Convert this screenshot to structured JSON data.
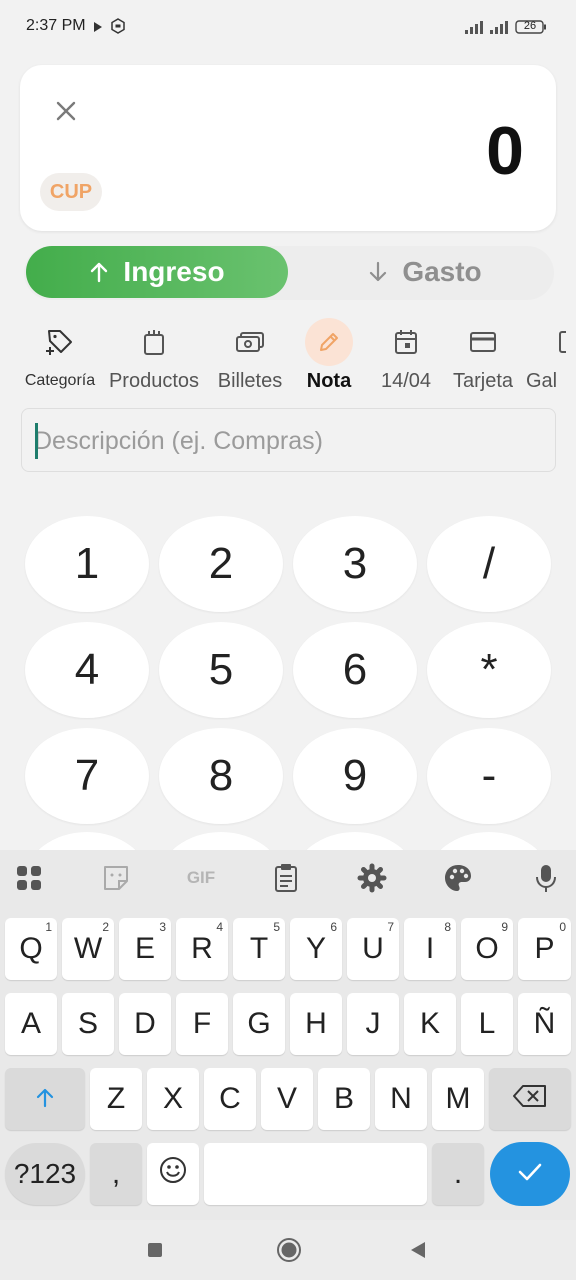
{
  "status_bar": {
    "time": "2:37 PM",
    "battery": "26"
  },
  "amount_card": {
    "amount": "0",
    "currency": "CUP"
  },
  "type_toggle": {
    "income_label": "Ingreso",
    "expense_label": "Gasto"
  },
  "categories": [
    {
      "label": "Categoría",
      "icon": "tag-add-icon"
    },
    {
      "label": "Productos",
      "icon": "shopping-bag-icon"
    },
    {
      "label": "Billetes",
      "icon": "banknote-icon"
    },
    {
      "label": "Nota",
      "icon": "pencil-icon"
    },
    {
      "label": "14/04",
      "icon": "calendar-icon"
    },
    {
      "label": "Tarjeta",
      "icon": "card-icon"
    },
    {
      "label": "Gal",
      "icon": "gallery-icon"
    }
  ],
  "selected_category": "Nota",
  "description": {
    "placeholder": "Descripción (ej. Compras)",
    "value": ""
  },
  "numpad": {
    "rows": [
      [
        "1",
        "2",
        "3",
        "/"
      ],
      [
        "4",
        "5",
        "6",
        "*"
      ],
      [
        "7",
        "8",
        "9",
        "-"
      ]
    ]
  },
  "keyboard": {
    "toolbar": [
      "apps-icon",
      "sticker-icon",
      "gif-icon",
      "clipboard-icon",
      "settings-icon",
      "palette-icon",
      "microphone-icon"
    ],
    "gif_label": "GIF",
    "row1": [
      "Q",
      "W",
      "E",
      "R",
      "T",
      "Y",
      "U",
      "I",
      "O",
      "P"
    ],
    "row1_hints": [
      "1",
      "2",
      "3",
      "4",
      "5",
      "6",
      "7",
      "8",
      "9",
      "0"
    ],
    "row2": [
      "A",
      "S",
      "D",
      "F",
      "G",
      "H",
      "J",
      "K",
      "L",
      "Ñ"
    ],
    "row3": [
      "Z",
      "X",
      "C",
      "V",
      "B",
      "N",
      "M"
    ],
    "symbols_label": "?123",
    "comma": ",",
    "period": ".",
    "accent_color": "#2493e0"
  },
  "colors": {
    "income": "#4caf50",
    "currency": "#f0a466",
    "cursor": "#1e7d6c"
  }
}
